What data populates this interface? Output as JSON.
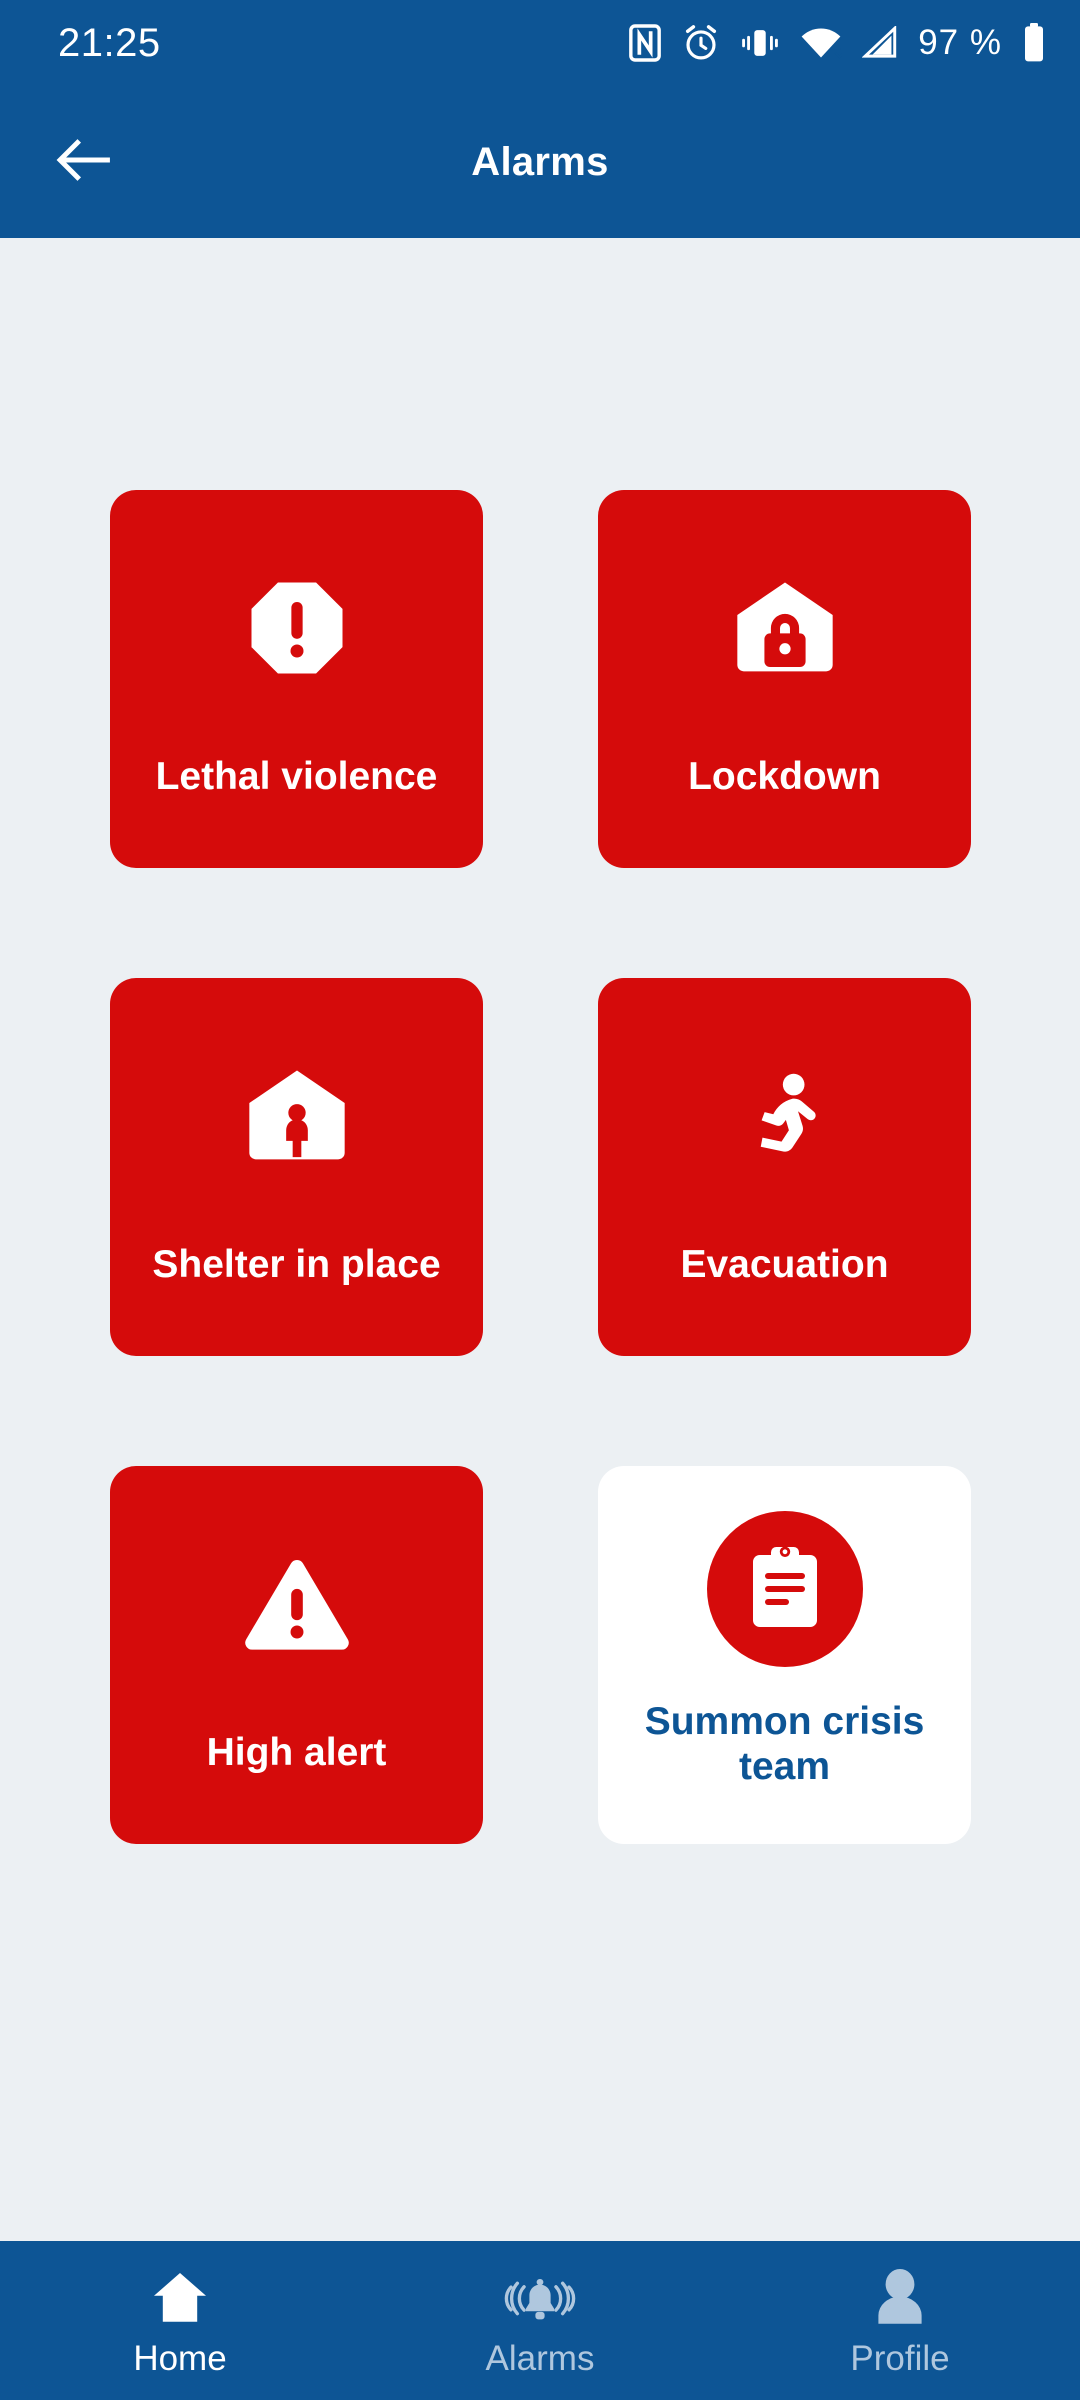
{
  "statusbar": {
    "time": "21:25",
    "battery_percent": "97 %",
    "icons": [
      "nfc-icon",
      "alarm-clock-icon",
      "vibrate-icon",
      "wifi-icon",
      "cellular-signal-icon",
      "battery-icon"
    ]
  },
  "appbar": {
    "title": "Alarms",
    "back_icon": "arrow-left-icon"
  },
  "theme": {
    "brand_blue": "#0D5595",
    "alarm_red": "#D50B0B",
    "page_background": "#ECF0F3",
    "card_white": "#FFFFFF",
    "nav_inactive": "#AFC7DE"
  },
  "alarms": [
    {
      "label": "Lethal violence",
      "icon": "octagon-exclamation-icon",
      "style": "red"
    },
    {
      "label": "Lockdown",
      "icon": "house-lock-icon",
      "style": "red"
    },
    {
      "label": "Shelter in place",
      "icon": "house-person-icon",
      "style": "red"
    },
    {
      "label": "Evacuation",
      "icon": "running-person-icon",
      "style": "red"
    },
    {
      "label": "High alert",
      "icon": "warning-triangle-icon",
      "style": "red"
    },
    {
      "label": "Summon crisis team",
      "icon": "clipboard-icon",
      "style": "white"
    }
  ],
  "bottomnav": {
    "items": [
      {
        "label": "Home",
        "icon": "home-icon",
        "active": true
      },
      {
        "label": "Alarms",
        "icon": "bell-ring-icon",
        "active": false
      },
      {
        "label": "Profile",
        "icon": "person-icon",
        "active": false
      }
    ]
  }
}
